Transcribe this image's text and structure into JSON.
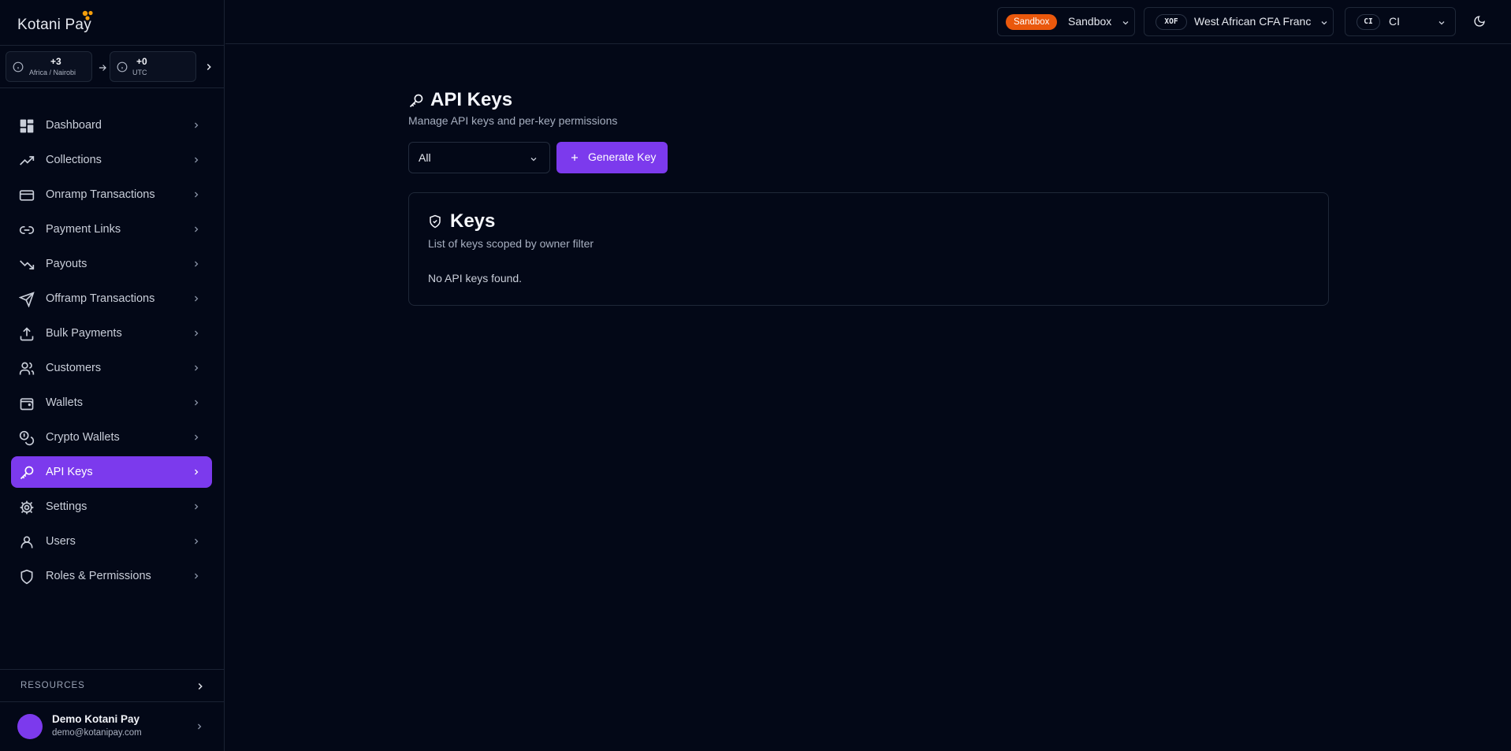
{
  "brand": {
    "name": "Kotani Pay",
    "accent": "#7c3aed",
    "sandbox_color": "#ea580c"
  },
  "timezones": {
    "from": {
      "offset": "+3",
      "zone": "Africa / Nairobi"
    },
    "to": {
      "offset": "+0",
      "zone": "UTC"
    }
  },
  "sidebar": {
    "items": [
      {
        "label": "Dashboard",
        "icon": "dashboard-icon"
      },
      {
        "label": "Collections",
        "icon": "trending-up-icon"
      },
      {
        "label": "Onramp Transactions",
        "icon": "credit-card-icon"
      },
      {
        "label": "Payment Links",
        "icon": "link-icon"
      },
      {
        "label": "Payouts",
        "icon": "trending-down-icon"
      },
      {
        "label": "Offramp Transactions",
        "icon": "send-icon"
      },
      {
        "label": "Bulk Payments",
        "icon": "upload-icon"
      },
      {
        "label": "Customers",
        "icon": "users-icon"
      },
      {
        "label": "Wallets",
        "icon": "wallet-icon"
      },
      {
        "label": "Crypto Wallets",
        "icon": "coins-icon"
      },
      {
        "label": "API Keys",
        "icon": "key-icon",
        "active": true
      },
      {
        "label": "Settings",
        "icon": "gear-icon"
      },
      {
        "label": "Users",
        "icon": "user-icon"
      },
      {
        "label": "Roles & Permissions",
        "icon": "shield-icon"
      }
    ],
    "resources_label": "RESOURCES",
    "user": {
      "name": "Demo Kotani Pay",
      "email": "demo@kotanipay.com"
    }
  },
  "topbar": {
    "environment": {
      "badge": "Sandbox",
      "value": "Sandbox"
    },
    "currency": {
      "code": "XOF",
      "value": "West African CFA Franc"
    },
    "country": {
      "code": "CI",
      "value": "CI"
    },
    "theme_icon": "moon-icon"
  },
  "main": {
    "title": "API Keys",
    "subtitle": "Manage API keys and per-key permissions",
    "filter": {
      "value": "All"
    },
    "generate_label": "Generate Key",
    "card": {
      "title": "Keys",
      "subtitle": "List of keys scoped by owner filter",
      "empty": "No API keys found."
    }
  }
}
